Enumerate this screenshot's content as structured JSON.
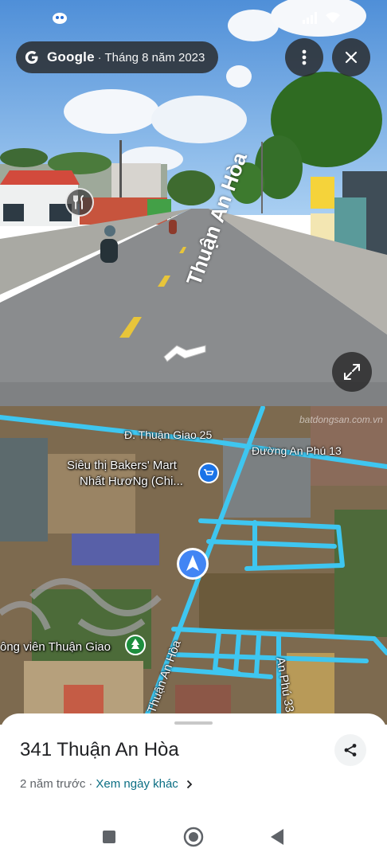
{
  "header": {
    "brand": "Google",
    "separator": "·",
    "capture_date": "Tháng 8 năm 2023"
  },
  "street_view": {
    "street_label": "Thuận An Hòa",
    "icons": {
      "more": "more-vert-icon",
      "close": "close-icon",
      "expand": "expand-icon",
      "restaurant": "restaurant-icon",
      "navigate": "chevron-arrow-icon"
    }
  },
  "map": {
    "roads": [
      "Đ. Thuận Giao 25",
      "Đường An Phú 13",
      "Thuận An Hòa",
      "An Phú 33"
    ],
    "poi": {
      "store_line1": "Siêu thị Bakers' Mart",
      "store_line2": "Nhất HươNg (Chi...",
      "park": "ông viên Thuận Giao"
    },
    "watermark": "batdongsan.com.vn",
    "colors": {
      "road": "#3ec6f0",
      "store_pin": "#1a73e8",
      "park_pin": "#1e8e3e",
      "location": "#4285f4"
    }
  },
  "sheet": {
    "address": "341 Thuận An Hòa",
    "age": "2 năm trước",
    "separator": "·",
    "other_dates_link": "Xem ngày khác",
    "share_icon": "share-icon"
  },
  "system_nav": {
    "recents": "square-icon",
    "home": "circle-icon",
    "back": "triangle-back-icon"
  }
}
